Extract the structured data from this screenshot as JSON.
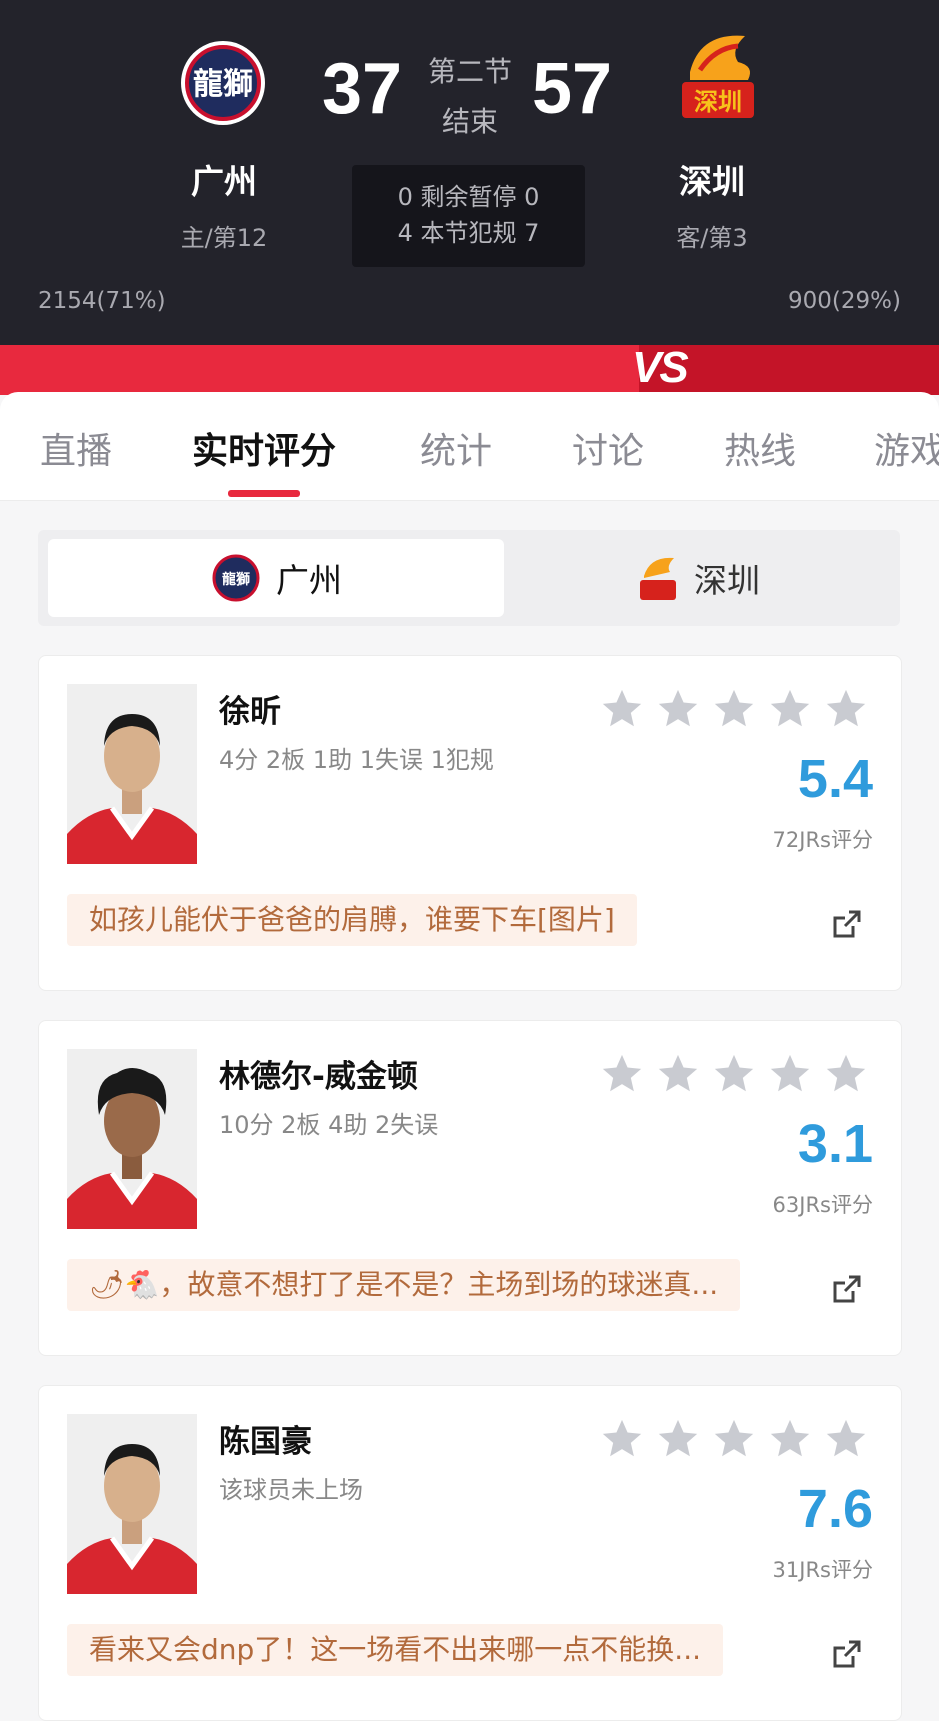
{
  "game": {
    "home": {
      "name": "广州",
      "sub": "主/第12",
      "score": "37",
      "pct": "2154(71%)",
      "logo_text": "龍獅"
    },
    "away": {
      "name": "深圳",
      "sub": "客/第3",
      "score": "57",
      "pct": "900(29%)",
      "logo_text": "深圳"
    },
    "period": "第二节",
    "status": "结束",
    "timeouts": "0 剩余暂停 0",
    "fouls": "4 本节犯规 7",
    "vs": "VS"
  },
  "tabs": [
    {
      "label": "直播"
    },
    {
      "label": "实时评分"
    },
    {
      "label": "统计"
    },
    {
      "label": "讨论"
    },
    {
      "label": "热线"
    },
    {
      "label": "游戏"
    }
  ],
  "switch": {
    "home": "广州",
    "away": "深圳"
  },
  "players": [
    {
      "name": "徐昕",
      "stats": "4分 2板 1助 1失误 1犯规",
      "rating": "5.4",
      "count": "72JRs评分",
      "comment": "如孩儿能伏于爸爸的肩膊，谁要下车[图片]",
      "hair": "short"
    },
    {
      "name": "林德尔-威金顿",
      "stats": "10分 2板 4助 2失误",
      "rating": "3.1",
      "count": "63JRs评分",
      "comment": "🌶🐔，故意不想打了是不是？主场到场的球迷真...",
      "hair": "curly"
    },
    {
      "name": "陈国豪",
      "stats": "该球员未上场",
      "rating": "7.6",
      "count": "31JRs评分",
      "comment": "看来又会dnp了！这一场看不出来哪一点不能换...",
      "hair": "short"
    }
  ],
  "colors": {
    "accent": "#e8293e",
    "rating": "#2f9bdc",
    "header_bg": "#23232b",
    "comment_bg": "#fdf1ea"
  }
}
